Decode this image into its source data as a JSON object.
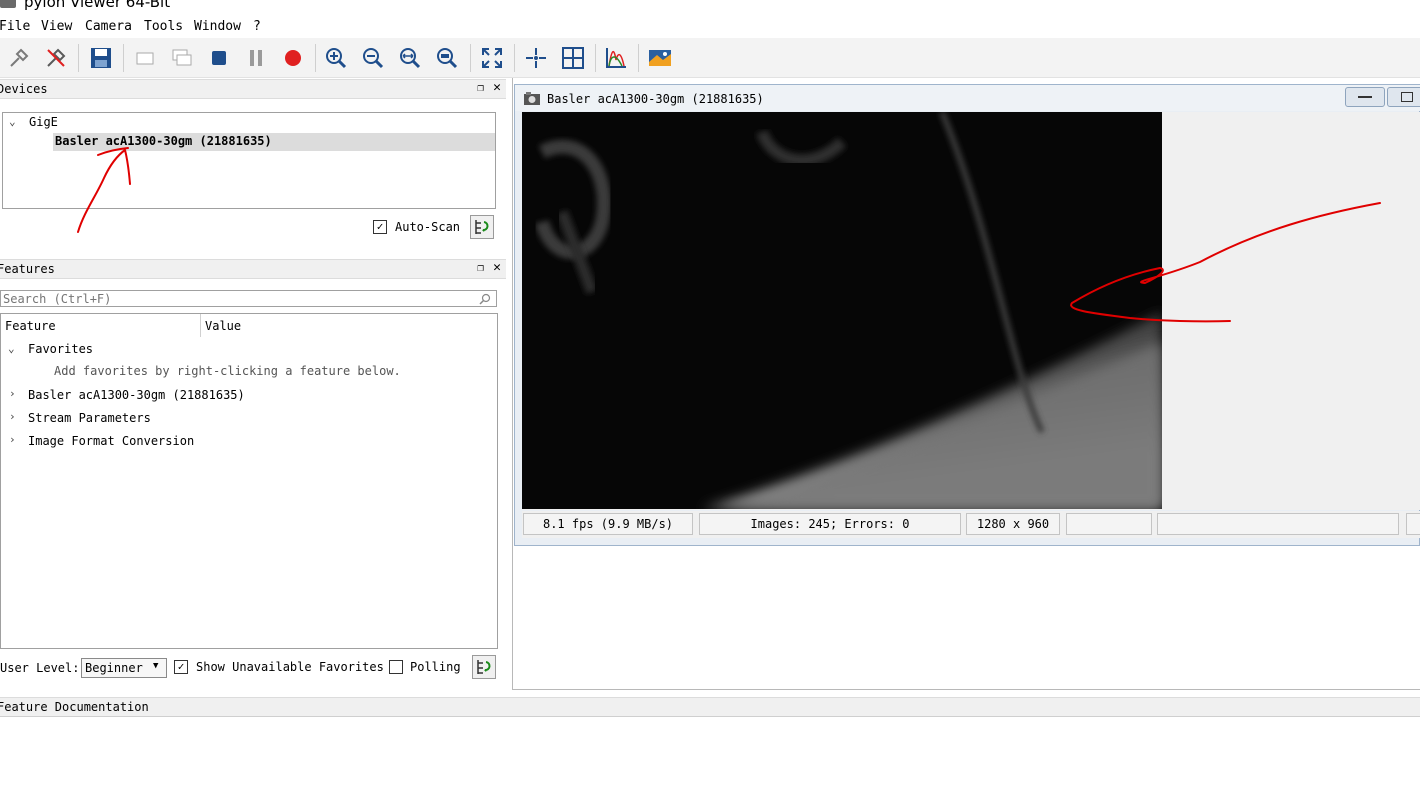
{
  "window": {
    "title": "pylon Viewer 64-Bit"
  },
  "menu": [
    "File",
    "View",
    "Camera",
    "Tools",
    "Window",
    "?"
  ],
  "toolbar": {
    "buttons": [
      "open-device-icon",
      "close-device-icon",
      "save-icon",
      "single-shot-icon",
      "continuous-shot-icon",
      "stop-icon",
      "pause-icon",
      "record-icon",
      "zoom-in-icon",
      "zoom-out-icon",
      "zoom-fit-icon",
      "zoom-100-icon",
      "fullscreen-icon",
      "crosshair-icon",
      "grid-icon",
      "histogram-icon",
      "image-view-icon"
    ]
  },
  "devices": {
    "header": "Devices",
    "group": "GigE",
    "device": "Basler acA1300-30gm (21881635)",
    "auto_scan_label": "Auto-Scan",
    "auto_scan_checked": true
  },
  "features": {
    "header": "Features",
    "search_placeholder": "Search (Ctrl+F)",
    "col_feature": "Feature",
    "col_value": "Value",
    "favorites_label": "Favorites",
    "favorites_hint": "Add favorites by right-clicking a feature below.",
    "items": [
      "Basler acA1300-30gm (21881635)",
      "Stream Parameters",
      "Image Format Conversion"
    ],
    "user_level_label": "User Level:",
    "user_level_value": "Beginner",
    "show_unavailable_label": "Show Unavailable Favorites",
    "show_unavailable_checked": true,
    "polling_label": "Polling",
    "polling_checked": false
  },
  "feature_doc": {
    "header": "Feature Documentation"
  },
  "image_window": {
    "title": "Basler acA1300-30gm (21881635)",
    "fps": "8.1 fps (9.9 MB/s)",
    "images": "Images: 245; Errors: 0",
    "resolution": "1280 x 960"
  },
  "colors": {
    "annotation": "#e00000",
    "stop": "#1f4e8c",
    "record": "#e02020"
  }
}
